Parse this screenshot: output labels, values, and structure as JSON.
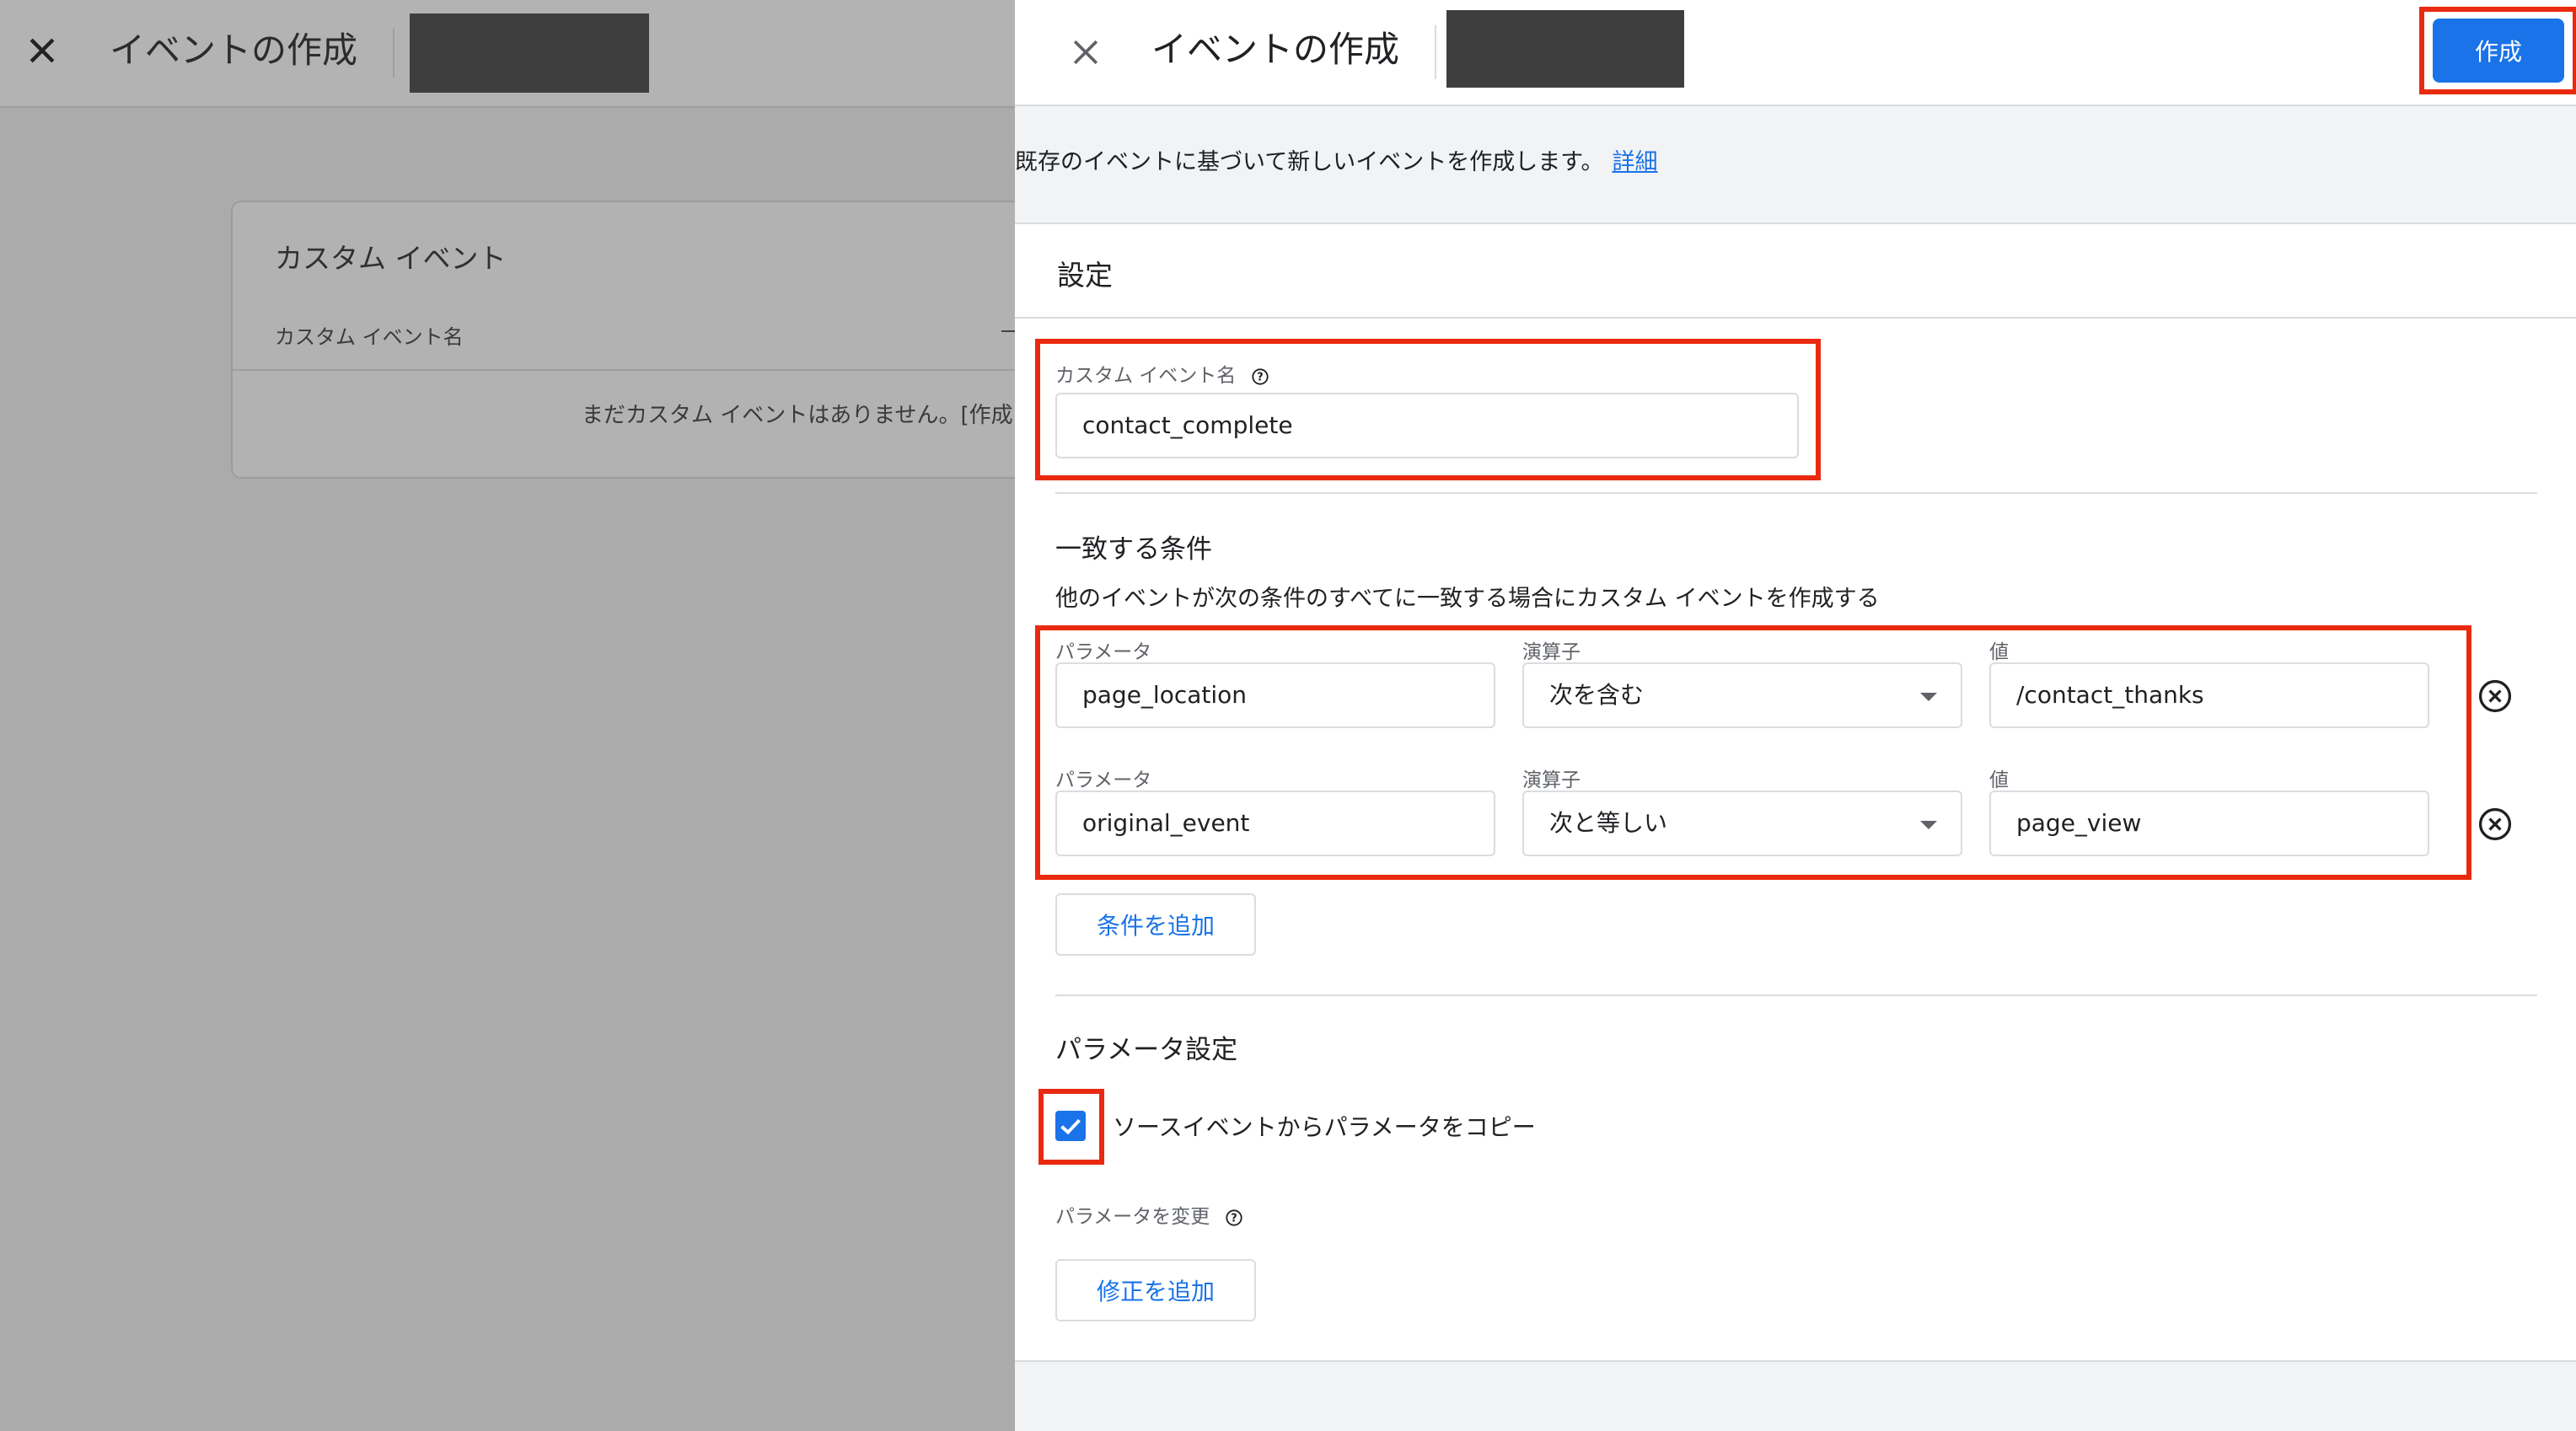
{
  "background": {
    "header_title": "イベントの作成",
    "card_title": "カスタム イベント",
    "column_label": "カスタム イベント名",
    "empty_message": "まだカスタム イベントはありません。[作成"
  },
  "panel": {
    "title": "イベントの作成",
    "create_label": "作成",
    "intro_text": "既存のイベントに基づいて新しいイベントを作成します。",
    "intro_link": "詳細",
    "settings_title": "設定",
    "event_name": {
      "label": "カスタム イベント名",
      "value": "contact_complete"
    },
    "conditions": {
      "title": "一致する条件",
      "description": "他のイベントが次の条件のすべてに一致する場合にカスタム イベントを作成する",
      "rows": [
        {
          "param_label": "パラメータ",
          "param_value": "page_location",
          "operator_label": "演算子",
          "operator_value": "次を含む",
          "value_label": "値",
          "value": "/contact_thanks"
        },
        {
          "param_label": "パラメータ",
          "param_value": "original_event",
          "operator_label": "演算子",
          "operator_value": "次と等しい",
          "value_label": "値",
          "value": "page_view"
        }
      ],
      "add_label": "条件を追加"
    },
    "params": {
      "title": "パラメータ設定",
      "copy_label": "ソースイベントからパラメータをコピー",
      "copy_checked": true,
      "modify_label": "パラメータを変更",
      "add_modify_label": "修正を追加"
    }
  },
  "colors": {
    "accent": "#1a73e8",
    "highlight": "#ea2a10"
  }
}
